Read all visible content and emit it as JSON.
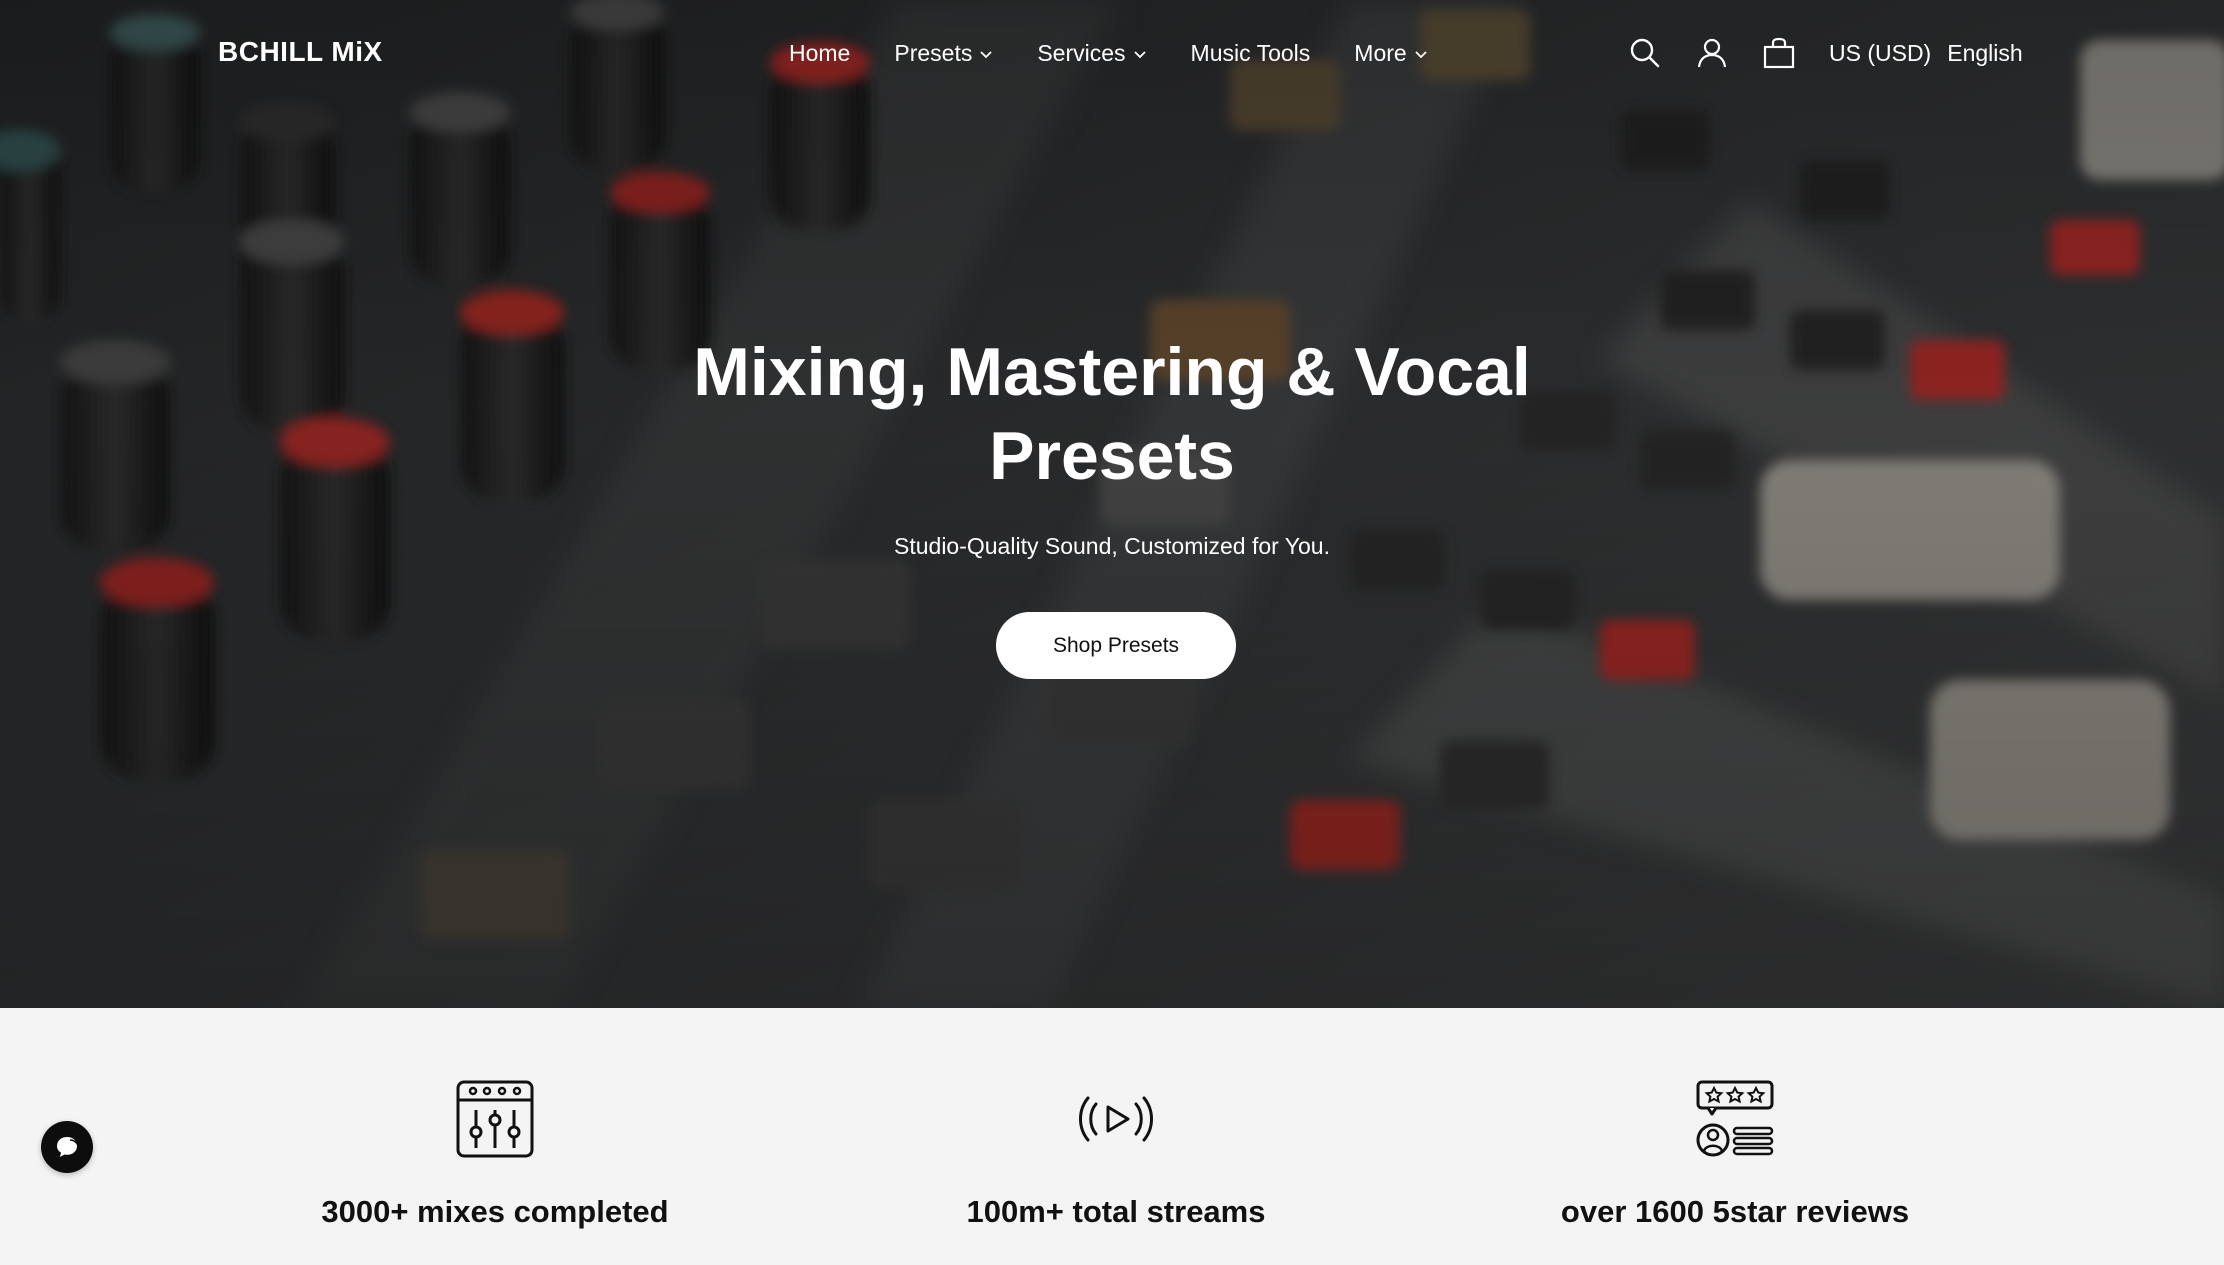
{
  "header": {
    "logo_text": "BCHILL MiX",
    "nav": [
      {
        "label": "Home"
      },
      {
        "label": "Presets"
      },
      {
        "label": "Services"
      },
      {
        "label": "Music Tools"
      },
      {
        "label": "More"
      }
    ],
    "currency": "US (USD)",
    "language": "English",
    "icons": [
      "search-icon",
      "account-icon",
      "cart-icon"
    ]
  },
  "hero": {
    "title": "Mixing, Mastering & Vocal Presets",
    "subtitle": "Studio-Quality Sound, Customized for You.",
    "button_label": "Shop Presets"
  },
  "stats": [
    {
      "icon": "mixer-faders-icon",
      "label": "3000+ mixes completed"
    },
    {
      "icon": "play-broadcast-icon",
      "label": "100m+ total streams"
    },
    {
      "icon": "star-reviews-icon",
      "label": "over 1600 5star reviews"
    }
  ],
  "colors": {
    "hero_overlay": "#1d1f21",
    "stats_background": "#f4f4f4",
    "button_background": "#ffffff",
    "text_light": "#ffffff",
    "text_dark": "#111111",
    "accent_knob_red": "#c8312d"
  }
}
